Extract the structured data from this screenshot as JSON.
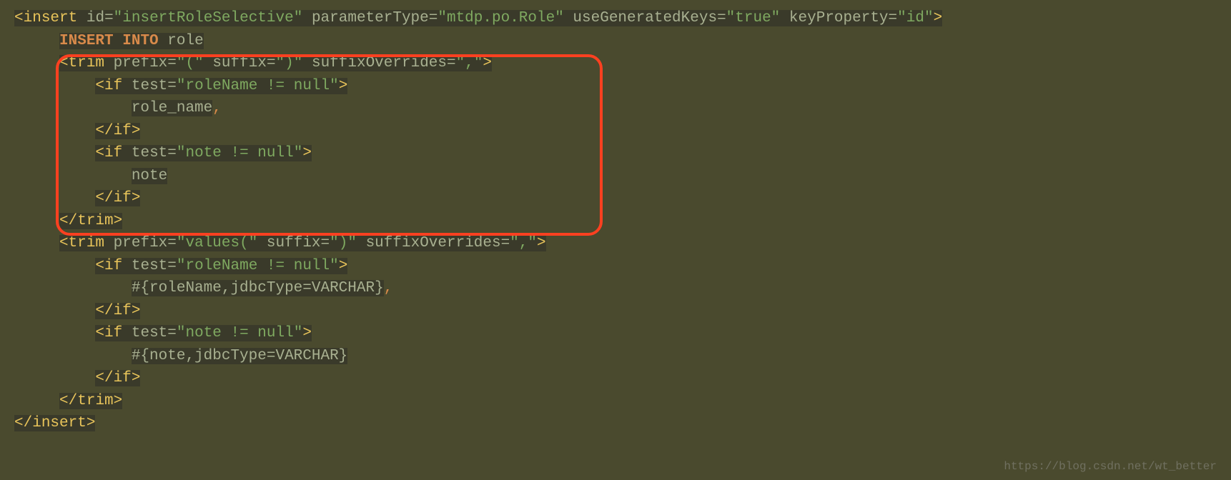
{
  "code": {
    "line1": {
      "tag": "insert",
      "attr_id_name": "id",
      "attr_id_value": "\"insertRoleSelective\"",
      "attr_paramtype_name": "parameterType",
      "attr_paramtype_value": "\"mtdp.po.Role\"",
      "attr_usegenkeys_name": "useGeneratedKeys",
      "attr_usegenkeys_value": "\"true\"",
      "attr_keyprop_name": "keyProperty",
      "attr_keyprop_value": "\"id\""
    },
    "line2": {
      "sql_keyword1": "INSERT",
      "sql_keyword2": "INTO",
      "table_name": "role"
    },
    "line3": {
      "tag": "trim",
      "attr_prefix_name": "prefix",
      "attr_prefix_value": "\"(\"",
      "attr_suffix_name": "suffix",
      "attr_suffix_value": "\")\"",
      "attr_suffixov_name": "suffixOverrides",
      "attr_suffixov_value": "\",\""
    },
    "line4": {
      "tag": "if",
      "attr_test_name": "test",
      "attr_test_value": "\"roleName != null\""
    },
    "line5": {
      "content": "role_name",
      "comma": ","
    },
    "line6": {
      "tag": "if"
    },
    "line7": {
      "tag": "if",
      "attr_test_name": "test",
      "attr_test_value": "\"note != null\""
    },
    "line8": {
      "content": "note"
    },
    "line9": {
      "tag": "if"
    },
    "line10": {
      "tag": "trim"
    },
    "line11": {
      "tag": "trim",
      "attr_prefix_name": "prefix",
      "attr_prefix_value": "\"values(\"",
      "attr_suffix_name": "suffix",
      "attr_suffix_value": "\")\"",
      "attr_suffixov_name": "suffixOverrides",
      "attr_suffixov_value": "\",\""
    },
    "line12": {
      "tag": "if",
      "attr_test_name": "test",
      "attr_test_value": "\"roleName != null\""
    },
    "line13": {
      "content": "#{roleName,jdbcType=VARCHAR}",
      "comma": ","
    },
    "line14": {
      "tag": "if"
    },
    "line15": {
      "tag": "if",
      "attr_test_name": "test",
      "attr_test_value": "\"note != null\""
    },
    "line16": {
      "content": "#{note,jdbcType=VARCHAR}"
    },
    "line17": {
      "tag": "if"
    },
    "line18": {
      "tag": "trim"
    },
    "line19": {
      "tag": "insert"
    }
  },
  "watermark": "https://blog.csdn.net/wt_better"
}
